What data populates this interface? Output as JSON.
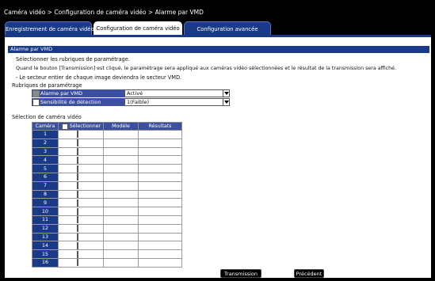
{
  "breadcrumb": "Caméra vidéo > Configuration de caméra vidéo > Alarme par VMD",
  "tabs": [
    {
      "label": "Enregistrement de caméra vidéo",
      "active": false
    },
    {
      "label": "Configuration de caméra vidéo",
      "active": true
    },
    {
      "label": "Configuration avancée",
      "active": false
    }
  ],
  "section": {
    "title": "Alarme par VMD"
  },
  "instructions": {
    "line1": "Sélectionner les rubriques de paramétrage.",
    "line2": "Quand le bouton [Transmission] est cliqué, le paramétrage sera appliqué aux caméras vidéo sélectionnées et le résultat de la transmission sera affiché.",
    "line3": "- Le secteur entier de chaque image deviendra le secteur VMD."
  },
  "settings": {
    "heading": "Rubriques de paramétrage",
    "rows": [
      {
        "label": "Alarme par VMD",
        "value": "Activé",
        "checkbox_disabled": true
      },
      {
        "label": "Sensibilité de détection",
        "value": "1(Faible)",
        "checkbox_disabled": false
      }
    ]
  },
  "camera_selection": {
    "heading": "Sélection de caméra vidéo",
    "columns": {
      "camera": "Caméra",
      "select": "Sélectionner",
      "model": "Modèle",
      "results": "Résultats"
    },
    "rows": [
      "1",
      "2",
      "3",
      "4",
      "5",
      "6",
      "7",
      "8",
      "9",
      "10",
      "11",
      "12",
      "13",
      "14",
      "15",
      "16"
    ]
  },
  "buttons": {
    "transmit": "Transmission",
    "previous": "Précédent"
  },
  "colors": {
    "accent": "#1a3a88",
    "header_cell": "#3b50a0",
    "background": "#000000"
  }
}
